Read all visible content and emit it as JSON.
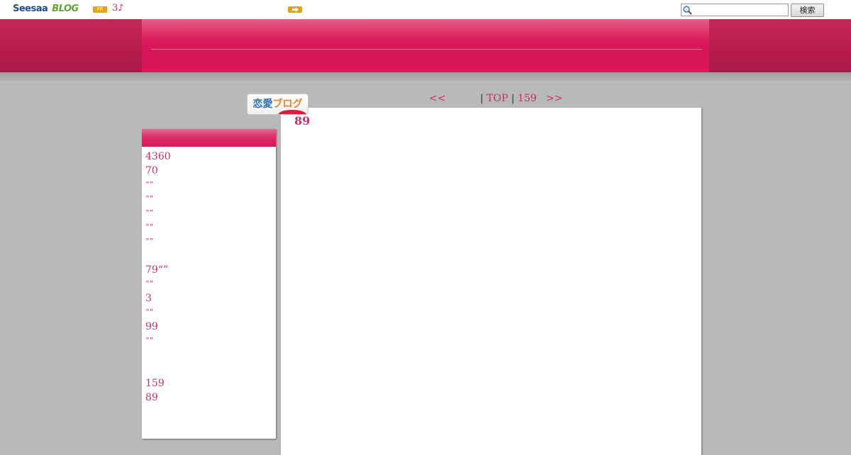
{
  "topbar": {
    "logo_seesaa": "Seesaa",
    "logo_blog": "BLOG",
    "pr_badge": "PR",
    "pr_text": "3♪",
    "search_placeholder": "",
    "search_button": "検索"
  },
  "ranking_banner": {
    "text_part1": "恋愛",
    "text_part2": "ブログ"
  },
  "pager": {
    "prev": "<<",
    "separator_left": "| ",
    "top": "TOP",
    "separator_mid": " | ",
    "current": "159",
    "next": ">>"
  },
  "sidebar": {
    "items": [
      "4360",
      "70",
      "“”",
      "“”",
      "“”",
      "“”",
      "“”",
      "",
      "79“”",
      "“”",
      "3",
      "“”",
      "99",
      "“”",
      "",
      "",
      "159",
      "89"
    ]
  },
  "main": {
    "title": "89"
  },
  "colors": {
    "accent": "#d8175b",
    "link": "#c8315f",
    "background": "#b8b9bb",
    "badge": "#e3a21a"
  }
}
